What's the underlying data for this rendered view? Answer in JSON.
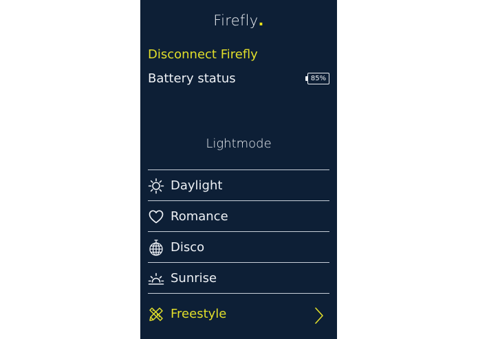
{
  "app": {
    "title": "Firefly",
    "title_dot": ".",
    "accent_color": "#e2df2a",
    "background_color": "#0d1f36"
  },
  "connection": {
    "disconnect_label": "Disconnect Firefly"
  },
  "battery": {
    "label": "Battery status",
    "value": "85%"
  },
  "lightmode": {
    "title": "Lightmode",
    "items": [
      {
        "label": "Daylight",
        "icon": "sun-icon"
      },
      {
        "label": "Romance",
        "icon": "heart-icon"
      },
      {
        "label": "Disco",
        "icon": "disco-ball-icon"
      },
      {
        "label": "Sunrise",
        "icon": "sunrise-icon"
      },
      {
        "label": "Freestyle",
        "icon": "pencil-ruler-icon",
        "has_chevron": true
      }
    ]
  }
}
